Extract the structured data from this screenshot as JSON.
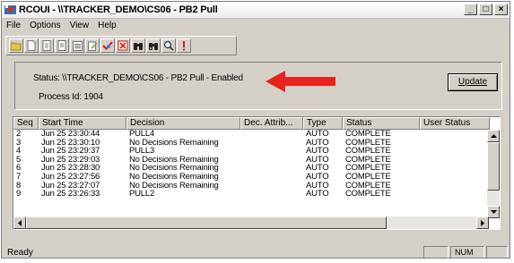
{
  "window": {
    "title": "RCOUI - \\\\TRACKER_DEMO\\CS06 - PB2 Pull",
    "minimize": "_",
    "maximize": "□",
    "close": "×"
  },
  "menu": [
    "File",
    "Options",
    "View",
    "Help"
  ],
  "toolbar": {
    "icons": [
      "open-folder-icon",
      "new-document-icon",
      "document-icon",
      "document-icon",
      "list-icon",
      "edit-icon",
      "checkmark-icon",
      "delete-icon",
      "binoculars-icon",
      "binoculars-icon",
      "magnifier-icon",
      "exclamation-icon"
    ]
  },
  "status": {
    "text": "Status: \\\\TRACKER_DEMO\\CS06 - PB2 Pull - Enabled",
    "process_id": "Process Id: 1904",
    "update_label": "Update",
    "arrow_color": "#e8231d"
  },
  "table": {
    "columns": [
      "Seq",
      "Start Time",
      "Decision",
      "Dec. Attrib...",
      "Type",
      "Status",
      "User Status"
    ],
    "rows": [
      [
        "2",
        "Jun 25 23:30:44",
        "PULL4",
        "",
        "AUTO",
        "COMPLETE",
        ""
      ],
      [
        "3",
        "Jun 25 23:30:10",
        "No Decisions Remaining",
        "",
        "AUTO",
        "COMPLETE",
        ""
      ],
      [
        "4",
        "Jun 25 23:29:37",
        "PULL3",
        "",
        "AUTO",
        "COMPLETE",
        ""
      ],
      [
        "5",
        "Jun 25 23:29:03",
        "No Decisions Remaining",
        "",
        "AUTO",
        "COMPLETE",
        ""
      ],
      [
        "6",
        "Jun 25 23:28:30",
        "No Decisions Remaining",
        "",
        "AUTO",
        "COMPLETE",
        ""
      ],
      [
        "7",
        "Jun 25 23:27:56",
        "No Decisions Remaining",
        "",
        "AUTO",
        "COMPLETE",
        ""
      ],
      [
        "8",
        "Jun 25 23:27:07",
        "No Decisions Remaining",
        "",
        "AUTO",
        "COMPLETE",
        ""
      ],
      [
        "9",
        "Jun 25 23:26:33",
        "PULL2",
        "",
        "AUTO",
        "COMPLETE",
        ""
      ]
    ]
  },
  "statusbar": {
    "text": "Ready",
    "num": "NUM"
  }
}
